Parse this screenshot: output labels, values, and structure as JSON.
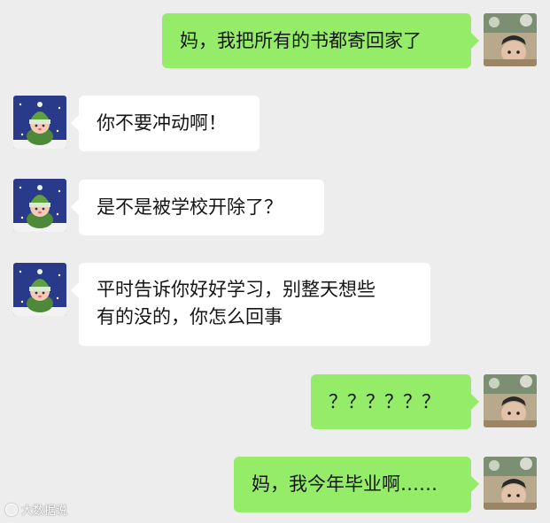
{
  "messages": [
    {
      "side": "out",
      "text": "妈，我把所有的书都寄回家了"
    },
    {
      "side": "in",
      "text": "你不要冲动啊！"
    },
    {
      "side": "in",
      "text": "是不是被学校开除了？"
    },
    {
      "side": "in",
      "text": "平时告诉你好好学习，别整天想些\n有的没的，你怎么回事"
    },
    {
      "side": "out",
      "text": "？？？？？？"
    },
    {
      "side": "out",
      "text": "妈，我今年毕业啊……"
    }
  ],
  "watermark": "大数据说",
  "colors": {
    "background": "#ededed",
    "bubble_in": "#ffffff",
    "bubble_out": "#95ec69",
    "text": "#151515"
  },
  "icons": {
    "mom_avatar": "snowman-in-green-hat-avatar",
    "user_avatar": "photo-avatar"
  }
}
